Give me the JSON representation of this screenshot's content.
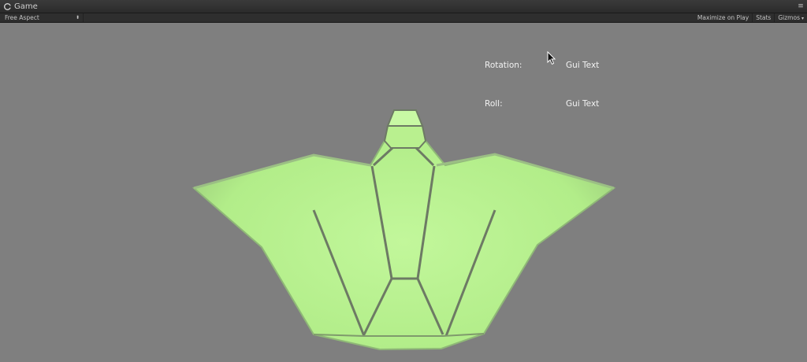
{
  "window": {
    "tab_title": "Game",
    "menu_icon": "window-menu-icon"
  },
  "toolbar": {
    "aspect_label": "Free Aspect",
    "maximize_label": "Maximize on Play",
    "stats_label": "Stats",
    "gizmos_label": "Gizmos"
  },
  "viewport": {
    "rotation_label": "Rotation:",
    "rotation_value": "Gui Text",
    "roll_label": "Roll:",
    "roll_value": "Gui Text"
  },
  "colors": {
    "ship_fill": "#b8f28f",
    "ship_edge": "#6f7d66",
    "background": "#7f7f7f"
  }
}
